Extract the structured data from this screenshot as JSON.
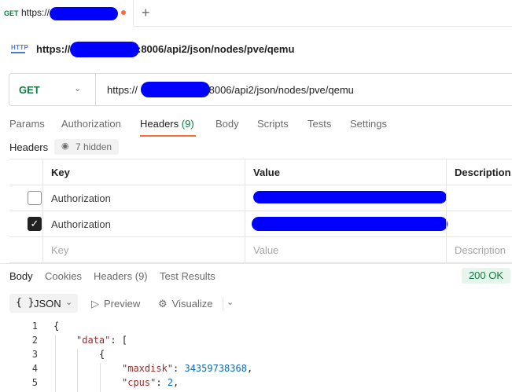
{
  "tab": {
    "method": "GET",
    "title": "https://",
    "add_icon": "plus-icon"
  },
  "request": {
    "icon_label": "HTTP",
    "title_prefix": "https://",
    "title_suffix": ":8006/api2/json/nodes/pve/qemu"
  },
  "url_bar": {
    "method": "GET",
    "url_prefix": "https://",
    "url_suffix": ":8006/api2/json/nodes/pve/qemu"
  },
  "request_tabs": [
    {
      "label": "Params"
    },
    {
      "label": "Authorization"
    },
    {
      "label": "Headers",
      "count": "(9)"
    },
    {
      "label": "Body"
    },
    {
      "label": "Scripts"
    },
    {
      "label": "Tests"
    },
    {
      "label": "Settings"
    }
  ],
  "headers_section": {
    "label": "Headers",
    "hidden_label": "7 hidden"
  },
  "headers_table": {
    "columns": [
      "Key",
      "Value",
      "Description"
    ],
    "rows": [
      {
        "key": "Authorization",
        "checked": false
      },
      {
        "key": "Authorization",
        "checked": true
      }
    ],
    "placeholder": {
      "key": "Key",
      "value": "Value",
      "description": "Description"
    }
  },
  "response": {
    "tabs": [
      {
        "label": "Body"
      },
      {
        "label": "Cookies"
      },
      {
        "label": "Headers (9)"
      },
      {
        "label": "Test Results"
      }
    ],
    "status": "200 OK",
    "format": {
      "icon": "{ }",
      "label": "JSON"
    },
    "preview_label": "Preview",
    "visualize_label": "Visualize",
    "code_lines": [
      {
        "n": "1",
        "text": "{"
      },
      {
        "n": "2",
        "key": "\"data\"",
        "rest": ": ["
      },
      {
        "n": "3",
        "text": "{"
      },
      {
        "n": "4",
        "key": "\"maxdisk\"",
        "rest": ": ",
        "value": "34359738368",
        "end": ","
      },
      {
        "n": "5",
        "key": "\"cpus\"",
        "rest": ": ",
        "value": "2",
        "end": ","
      }
    ]
  },
  "colors": {
    "accent": "#ff6c37",
    "method_green": "#0f7b3f",
    "redaction": "#0000ff",
    "json_key": "#9c2a2a",
    "json_number": "#0b6bb8"
  }
}
